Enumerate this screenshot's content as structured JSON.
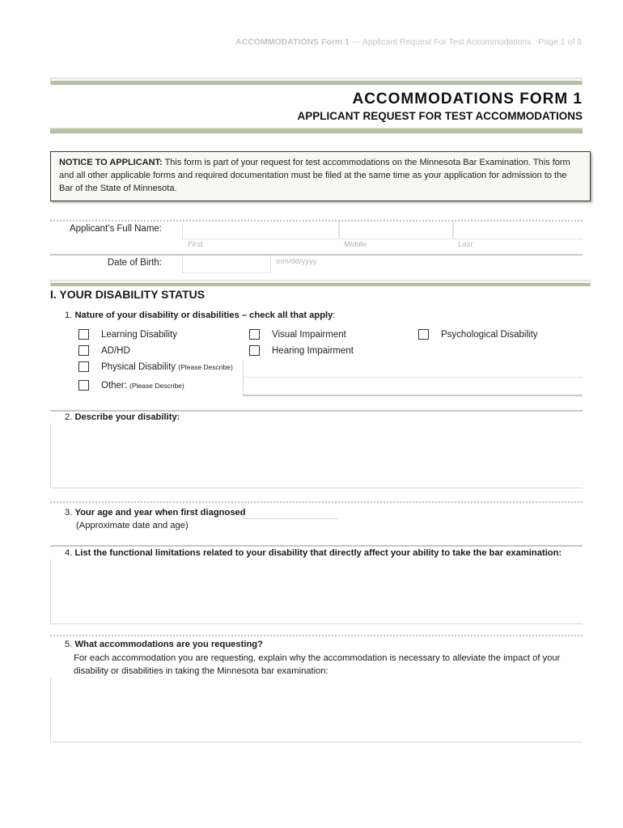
{
  "running_header": {
    "form_name": "ACCOMMODATIONS Form 1",
    "separator": " --- ",
    "description": "Applicant Request For Test Accommodations",
    "page": "Page 1 of 8"
  },
  "header": {
    "title": "ACCOMMODATIONS FORM 1",
    "subtitle": "APPLICANT REQUEST FOR TEST ACCOMMODATIONS"
  },
  "notice": {
    "label": "NOTICE TO APPLICANT:",
    "text": " This form is part of your request for test accommodations on the Minnesota Bar Examination. This form and all other applicable forms and required documentation must be filed at the same time as your application for admission to the Bar of the State of Minnesota."
  },
  "applicant": {
    "full_name_label": "Applicant's Full Name:",
    "first_hint": "First",
    "middle_hint": "Middle",
    "last_hint": "Last",
    "first_value": "",
    "middle_value": "",
    "last_value": "",
    "dob_label": "Date of Birth:",
    "dob_hint": "mm/dd/yyyy",
    "dob_value": ""
  },
  "section1": {
    "heading": "I. YOUR DISABILITY STATUS",
    "q1": {
      "number": "1. ",
      "text": "Nature of your disability or disabilities – check all that apply",
      "suffix": ":",
      "options": [
        {
          "label": "Learning Disability",
          "checked": false
        },
        {
          "label": "AD/HD",
          "checked": false
        },
        {
          "label": "Physical Disability",
          "note": "(Please Describe)",
          "checked": false
        },
        {
          "label": "Other:",
          "note": "(Please Describe)",
          "checked": false
        },
        {
          "label": "Visual Impairment",
          "checked": false
        },
        {
          "label": "Hearing Impairment",
          "checked": false
        },
        {
          "label": "Psychological Disability",
          "checked": false
        }
      ],
      "physical_description": "",
      "other_description": ""
    },
    "q2": {
      "number": "2. ",
      "text": "Describe your disability:",
      "value": ""
    },
    "q3": {
      "number": "3. ",
      "text": "Your age and year when first diagnosed",
      "note": "(Approximate date and age)",
      "value": ""
    },
    "q4": {
      "number": "4. ",
      "text": "List the functional limitations related to your disability that directly affect your ability to take the bar examination:",
      "value": ""
    },
    "q5": {
      "number": "5. ",
      "text": "What accommodations are you requesting?",
      "instructions": "For each accommodation you are requesting, explain why the accommodation is necessary to alleviate the impact of your disability or disabilities in taking the Minnesota bar examination:",
      "value": ""
    }
  }
}
